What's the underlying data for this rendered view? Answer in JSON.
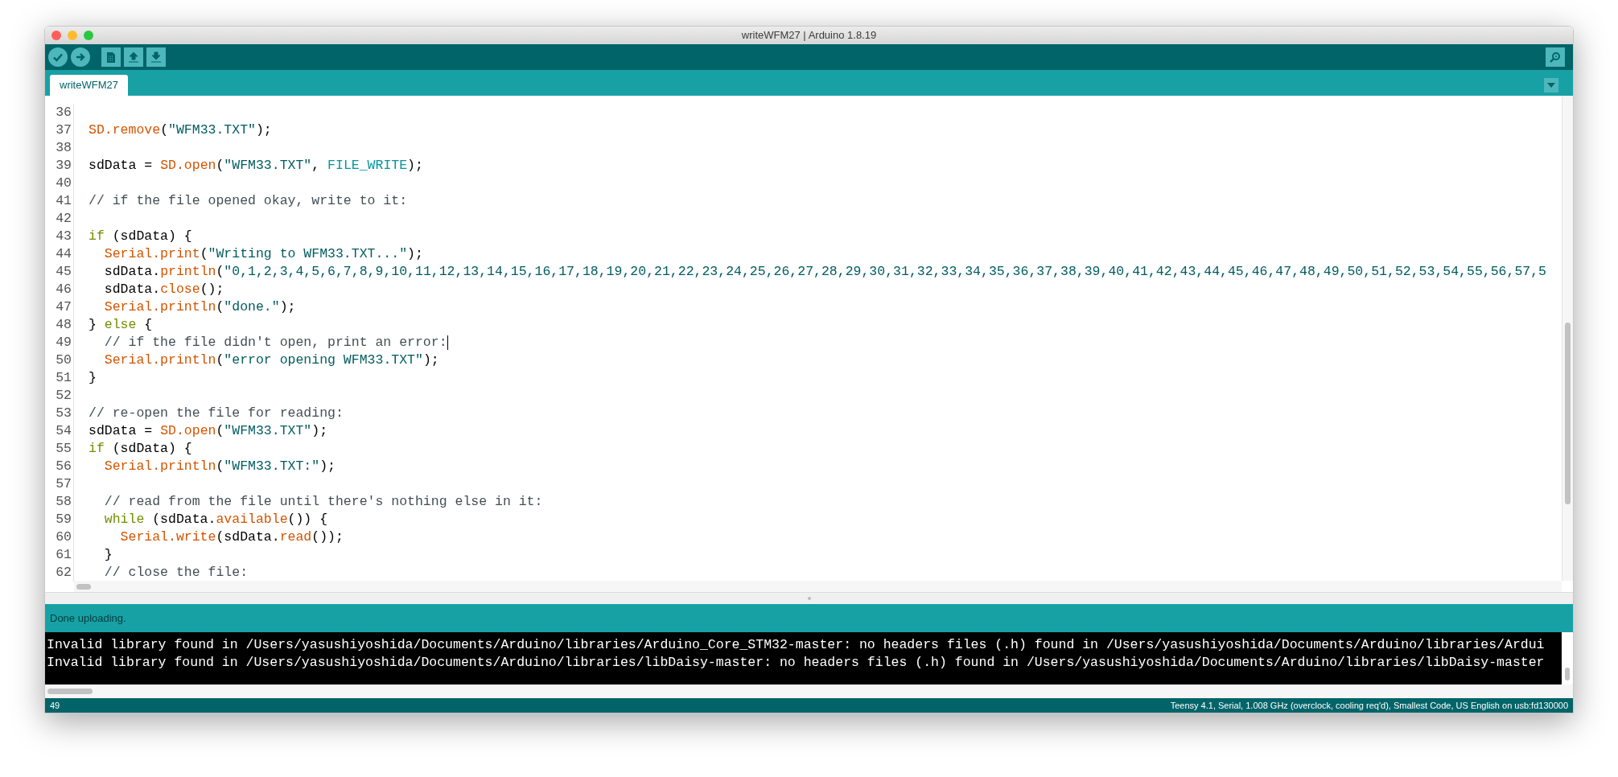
{
  "window": {
    "title": "writeWFM27 | Arduino 1.8.19"
  },
  "tabs": [
    {
      "label": "writeWFM27",
      "selected": true
    }
  ],
  "editor": {
    "lines": [
      {
        "number": "36",
        "cursor": false
      },
      {
        "number": "37",
        "cursor": false,
        "tokens": [
          {
            "text": "SD.remove",
            "kind": "function"
          },
          {
            "text": "(",
            "kind": "plain"
          },
          {
            "text": "\"WFM33.TXT\"",
            "kind": "string"
          },
          {
            "text": ");",
            "kind": "plain"
          }
        ]
      },
      {
        "number": "38",
        "cursor": false
      },
      {
        "number": "39",
        "cursor": false,
        "tokens": [
          {
            "text": "sdData = ",
            "kind": "plain"
          },
          {
            "text": "SD.open",
            "kind": "function"
          },
          {
            "text": "(",
            "kind": "plain"
          },
          {
            "text": "\"WFM33.TXT\"",
            "kind": "string"
          },
          {
            "text": ", ",
            "kind": "plain"
          },
          {
            "text": "FILE_WRITE",
            "kind": "constant"
          },
          {
            "text": ");",
            "kind": "plain"
          }
        ]
      },
      {
        "number": "40",
        "cursor": false
      },
      {
        "number": "41",
        "cursor": false,
        "tokens": [
          {
            "text": "// if the file opened okay, write to it:",
            "kind": "comment"
          }
        ]
      },
      {
        "number": "42",
        "cursor": false
      },
      {
        "number": "43",
        "cursor": false,
        "tokens": [
          {
            "text": "if",
            "kind": "keyword"
          },
          {
            "text": " (sdData) {",
            "kind": "plain"
          }
        ]
      },
      {
        "number": "44",
        "cursor": false,
        "tokens": [
          {
            "text": "  Serial.print",
            "kind": "function"
          },
          {
            "text": "(",
            "kind": "plain"
          },
          {
            "text": "\"Writing to WFM33.TXT...\"",
            "kind": "string"
          },
          {
            "text": ");",
            "kind": "plain"
          }
        ]
      },
      {
        "number": "45",
        "cursor": false,
        "tokens": [
          {
            "text": "  sdData.",
            "kind": "plain"
          },
          {
            "text": "println",
            "kind": "function"
          },
          {
            "text": "(",
            "kind": "plain"
          },
          {
            "text": "\"0,1,2,3,4,5,6,7,8,9,10,11,12,13,14,15,16,17,18,19,20,21,22,23,24,25,26,27,28,29,30,31,32,33,34,35,36,37,38,39,40,41,42,43,44,45,46,47,48,49,50,51,52,53,54,55,56,57,5",
            "kind": "string"
          }
        ]
      },
      {
        "number": "46",
        "cursor": false,
        "tokens": [
          {
            "text": "  sdData.",
            "kind": "plain"
          },
          {
            "text": "close",
            "kind": "function"
          },
          {
            "text": "();",
            "kind": "plain"
          }
        ]
      },
      {
        "number": "47",
        "cursor": false,
        "tokens": [
          {
            "text": "  Serial.println",
            "kind": "function"
          },
          {
            "text": "(",
            "kind": "plain"
          },
          {
            "text": "\"done.\"",
            "kind": "string"
          },
          {
            "text": ");",
            "kind": "plain"
          }
        ]
      },
      {
        "number": "48",
        "cursor": false,
        "tokens": [
          {
            "text": "} ",
            "kind": "plain"
          },
          {
            "text": "else",
            "kind": "keyword"
          },
          {
            "text": " {",
            "kind": "plain"
          }
        ]
      },
      {
        "number": "49",
        "cursor": true,
        "tokens": [
          {
            "text": "  // if the file didn't open, print an error:",
            "kind": "comment"
          }
        ]
      },
      {
        "number": "50",
        "cursor": false,
        "tokens": [
          {
            "text": "  Serial.println",
            "kind": "function"
          },
          {
            "text": "(",
            "kind": "plain"
          },
          {
            "text": "\"error opening WFM33.TXT\"",
            "kind": "string"
          },
          {
            "text": ");",
            "kind": "plain"
          }
        ]
      },
      {
        "number": "51",
        "cursor": false,
        "tokens": [
          {
            "text": "}",
            "kind": "plain"
          }
        ]
      },
      {
        "number": "52",
        "cursor": false
      },
      {
        "number": "53",
        "cursor": false,
        "tokens": [
          {
            "text": "// re-open the file for reading:",
            "kind": "comment"
          }
        ]
      },
      {
        "number": "54",
        "cursor": false,
        "tokens": [
          {
            "text": "sdData = ",
            "kind": "plain"
          },
          {
            "text": "SD.open",
            "kind": "function"
          },
          {
            "text": "(",
            "kind": "plain"
          },
          {
            "text": "\"WFM33.TXT\"",
            "kind": "string"
          },
          {
            "text": ");",
            "kind": "plain"
          }
        ]
      },
      {
        "number": "55",
        "cursor": false,
        "tokens": [
          {
            "text": "if",
            "kind": "keyword"
          },
          {
            "text": " (sdData) {",
            "kind": "plain"
          }
        ]
      },
      {
        "number": "56",
        "cursor": false,
        "tokens": [
          {
            "text": "  Serial.println",
            "kind": "function"
          },
          {
            "text": "(",
            "kind": "plain"
          },
          {
            "text": "\"WFM33.TXT:\"",
            "kind": "string"
          },
          {
            "text": ");",
            "kind": "plain"
          }
        ]
      },
      {
        "number": "57",
        "cursor": false
      },
      {
        "number": "58",
        "cursor": false,
        "tokens": [
          {
            "text": "  // read from the file until there's nothing else in it:",
            "kind": "comment"
          }
        ]
      },
      {
        "number": "59",
        "cursor": false,
        "tokens": [
          {
            "text": "  while",
            "kind": "keyword"
          },
          {
            "text": " (sdData.",
            "kind": "plain"
          },
          {
            "text": "available",
            "kind": "function"
          },
          {
            "text": "()) {",
            "kind": "plain"
          }
        ]
      },
      {
        "number": "60",
        "cursor": false,
        "tokens": [
          {
            "text": "    Serial.write",
            "kind": "function"
          },
          {
            "text": "(sdData.",
            "kind": "plain"
          },
          {
            "text": "read",
            "kind": "function"
          },
          {
            "text": "());",
            "kind": "plain"
          }
        ]
      },
      {
        "number": "61",
        "cursor": false,
        "tokens": [
          {
            "text": "  }",
            "kind": "plain"
          }
        ]
      },
      {
        "number": "62",
        "cursor": false,
        "tokens": [
          {
            "text": "  // close the file:",
            "kind": "comment"
          }
        ]
      }
    ]
  },
  "message_bar": {
    "text": "Done uploading."
  },
  "console": {
    "lines": [
      "Invalid library found in /Users/yasushiyoshida/Documents/Arduino/libraries/Arduino_Core_STM32-master: no headers files (.h) found in /Users/yasushiyoshida/Documents/Arduino/libraries/Ardui",
      "Invalid library found in /Users/yasushiyoshida/Documents/Arduino/libraries/libDaisy-master: no headers files (.h) found in /Users/yasushiyoshida/Documents/Arduino/libraries/libDaisy-master"
    ]
  },
  "status_bar": {
    "line": "49",
    "board": "Teensy 4.1, Serial, 1.008 GHz (overclock, cooling req'd), Smallest Code, US English on usb:fd130000"
  }
}
